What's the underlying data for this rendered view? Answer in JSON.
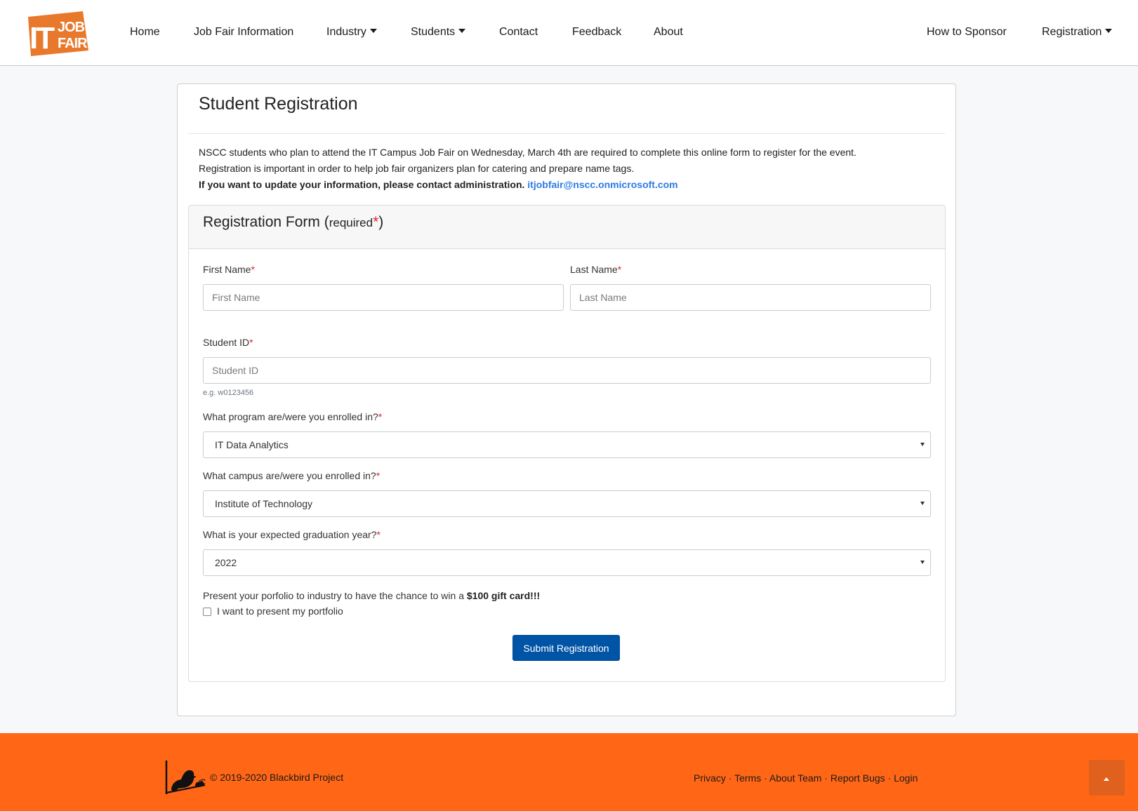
{
  "logo": {
    "text_it": "IT",
    "text_job": "JOB",
    "text_fair": "FAIR"
  },
  "nav": {
    "home": "Home",
    "job_fair_info": "Job Fair Information",
    "industry": "Industry",
    "students": "Students",
    "contact": "Contact",
    "feedback": "Feedback",
    "about": "About",
    "how_to_sponsor": "How to Sponsor",
    "registration": "Registration"
  },
  "page": {
    "title": "Student Registration",
    "intro_line1": "NSCC students who plan to attend the IT Campus Job Fair on Wednesday, March 4th are required to complete this online form to register for the event.",
    "intro_line2": "Registration is important in order to help job fair organizers plan for catering and prepare name tags.",
    "intro_line3": "If you want to update your information, please contact administration.",
    "contact_email": "itjobfair@nscc.onmicrosoft.com"
  },
  "form": {
    "title": "Registration Form",
    "title_paren_open": " (",
    "title_required": "required",
    "title_paren_close": ")",
    "required_mark": "*",
    "first_name": {
      "label": "First Name",
      "placeholder": "First Name",
      "value": ""
    },
    "last_name": {
      "label": "Last Name",
      "placeholder": "Last Name",
      "value": ""
    },
    "student_id": {
      "label": "Student ID",
      "placeholder": "Student ID",
      "value": "",
      "help": "e.g. w0123456"
    },
    "program": {
      "label": "What program are/were you enrolled in?",
      "selected": "IT Data Analytics"
    },
    "campus": {
      "label": "What campus are/were you enrolled in?",
      "selected": "Institute of Technology"
    },
    "grad_year": {
      "label": "What is your expected graduation year?",
      "selected": "2022"
    },
    "portfolio_promo": "Present your porfolio to industry to have the chance to win a",
    "portfolio_prize": "$100 gift card!!!",
    "portfolio_checkbox_label": "I want to present my portfolio",
    "portfolio_checked": false,
    "submit_label": "Submit Registration"
  },
  "footer": {
    "copyright": "© 2019-2020 Blackbird Project",
    "links": [
      "Privacy",
      "Terms",
      "About Team",
      "Report Bugs",
      "Login"
    ],
    "separator": " · "
  },
  "colors": {
    "brand_orange": "#ff6716",
    "primary_button": "#0054a6",
    "link": "#2c7be5",
    "required": "#e0242c"
  },
  "icons": {
    "back_to_top": "chevron-up-icon",
    "footer_logo": "blackbird-icon",
    "dropdown": "caret-down-icon"
  }
}
